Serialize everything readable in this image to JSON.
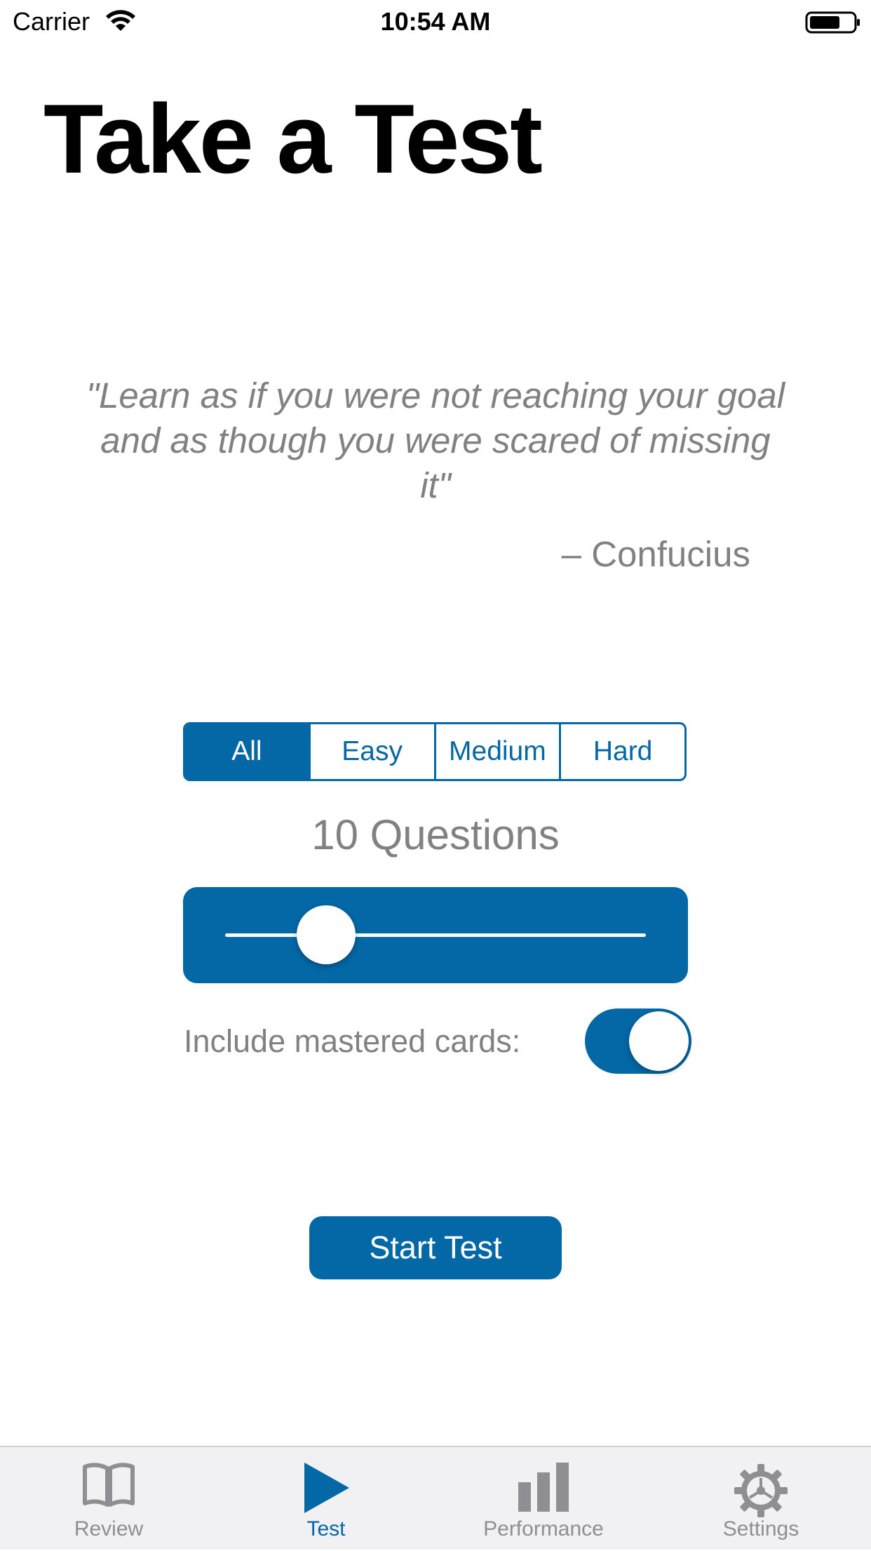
{
  "status_bar": {
    "carrier": "Carrier",
    "time": "10:54 AM",
    "wifi_icon": "wifi-icon",
    "battery_icon": "battery-icon"
  },
  "page": {
    "title": "Take a Test"
  },
  "quote": {
    "text": "\"Learn as if you were not reaching your goal and as though you were scared of missing it\"",
    "author": "– Confucius"
  },
  "difficulty": {
    "options": [
      "All",
      "Easy",
      "Medium",
      "Hard"
    ],
    "selected": "All"
  },
  "questions": {
    "label": "10 Questions",
    "slider_fraction": 0.24
  },
  "mastered": {
    "label": "Include mastered cards:",
    "enabled": true
  },
  "start_button": {
    "label": "Start Test"
  },
  "tab_bar": {
    "tabs": [
      {
        "label": "Review",
        "icon": "book-icon",
        "active": false
      },
      {
        "label": "Test",
        "icon": "play-icon",
        "active": true
      },
      {
        "label": "Performance",
        "icon": "bar-chart-icon",
        "active": false
      },
      {
        "label": "Settings",
        "icon": "gear-icon",
        "active": false
      }
    ]
  },
  "colors": {
    "accent": "#0467a6",
    "secondary_text": "#818181",
    "tab_inactive": "#8e8e93",
    "tab_bar_bg": "#f1f1f4"
  }
}
